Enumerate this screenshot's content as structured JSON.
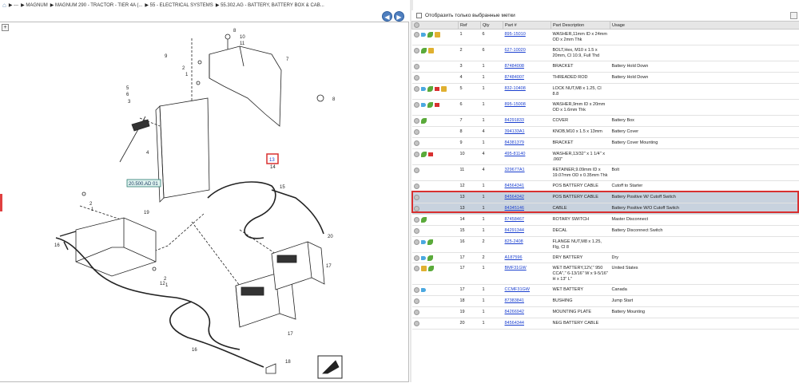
{
  "breadcrumb": [
    "---",
    "MAGNUM",
    "MAGNUM 290 - TRACTOR - TIER 4A (...",
    "55 - ELECTRICAL SYSTEMS",
    "55.302.AG - BATTERY, BATTERY BOX & CAB..."
  ],
  "filter_label": "Отобразить только выбранные метки",
  "columns": [
    "Ref",
    "Qty",
    "Part #",
    "Part Description",
    "Usage"
  ],
  "rows": [
    {
      "icons": [
        "arr",
        "leaf",
        "book"
      ],
      "ref": "1",
      "qty": "6",
      "part": "895-15010",
      "desc": "WASHER,11mm ID x 24mm OD x 2mm Thk",
      "usage": ""
    },
    {
      "icons": [
        "leaf",
        "book"
      ],
      "ref": "2",
      "qty": "6",
      "part": "627-10020",
      "desc": "BOLT,Hex, M10 x 1.5 x 20mm, Cl 10.9, Full Thd",
      "usage": ""
    },
    {
      "icons": [],
      "ref": "3",
      "qty": "1",
      "part": "87484008",
      "desc": "BRACKET",
      "usage": "Battery Hold Down"
    },
    {
      "icons": [],
      "ref": "4",
      "qty": "1",
      "part": "87484007",
      "desc": "THREADED ROD",
      "usage": "Battery Hold Down"
    },
    {
      "icons": [
        "arr",
        "leaf",
        "flag",
        "book"
      ],
      "ref": "5",
      "qty": "1",
      "part": "832-10408",
      "desc": "LOCK NUT,M8 x 1.25, Cl 8.8",
      "usage": ""
    },
    {
      "icons": [
        "arr",
        "leaf",
        "flag"
      ],
      "ref": "6",
      "qty": "1",
      "part": "895-15008",
      "desc": "WASHER,9mm ID x 20mm OD x 1.6mm Thk",
      "usage": ""
    },
    {
      "icons": [
        "leaf"
      ],
      "ref": "7",
      "qty": "1",
      "part": "84291833",
      "desc": "COVER",
      "usage": "Battery Box"
    },
    {
      "icons": [],
      "ref": "8",
      "qty": "4",
      "part": "394133A1",
      "desc": "KNOB,M10 x 1.5 x 13mm",
      "usage": "Battery Cover"
    },
    {
      "icons": [],
      "ref": "9",
      "qty": "1",
      "part": "84381379",
      "desc": "BRACKET",
      "usage": "Battery Cover Mounting"
    },
    {
      "icons": [
        "leaf",
        "flag"
      ],
      "ref": "10",
      "qty": "4",
      "part": "495-81140",
      "desc": "WASHER,13/32\" x 1 1/4\" x .060\"",
      "usage": ""
    },
    {
      "icons": [],
      "ref": "11",
      "qty": "4",
      "part": "329677A1",
      "desc": "RETAINER,9.09mm ID x 19.07mm OD x 0.35mm Thk",
      "usage": "Bolt"
    },
    {
      "icons": [],
      "ref": "12",
      "qty": "1",
      "part": "84564341",
      "desc": "POS BATTERY CABLE",
      "usage": "Cutoff to Starter"
    },
    {
      "icons": [],
      "ref": "13",
      "qty": "1",
      "part": "84564342",
      "desc": "POS BATTERY CABLE",
      "usage": "Battery Positive W/ Cutoff Switch",
      "sel": true
    },
    {
      "icons": [],
      "ref": "13",
      "qty": "1",
      "part": "84345146",
      "desc": "CABLE",
      "usage": "Battery Positive W/O Cutoff Switch",
      "sel": true
    },
    {
      "icons": [
        "leaf"
      ],
      "ref": "14",
      "qty": "1",
      "part": "87458467",
      "desc": "ROTARY SWITCH",
      "usage": "Master Disconnect"
    },
    {
      "icons": [],
      "ref": "15",
      "qty": "1",
      "part": "84291344",
      "desc": "DECAL",
      "usage": "Battery Disconnect Switch"
    },
    {
      "icons": [
        "arr",
        "leaf"
      ],
      "ref": "16",
      "qty": "2",
      "part": "825-2408",
      "desc": "FLANGE NUT,M8 x 1.25, Flg, Cl 8",
      "usage": ""
    },
    {
      "icons": [
        "arr",
        "leaf"
      ],
      "ref": "17",
      "qty": "2",
      "part": "A187596",
      "desc": "DRY BATTERY",
      "usage": "Dry"
    },
    {
      "icons": [
        "book",
        "leaf"
      ],
      "ref": "17",
      "qty": "1",
      "part": "BMF31GW",
      "desc": "WET BATTERY,12V,\" 950 CCA\",\" 6-13/16\" W x 9-5/16\" H x 13\" L\"",
      "usage": "United States"
    },
    {
      "icons": [
        "arr"
      ],
      "ref": "17",
      "qty": "1",
      "part": "CCMF31GW",
      "desc": "WET BATTERY",
      "usage": "Canada"
    },
    {
      "icons": [],
      "ref": "18",
      "qty": "1",
      "part": "87383841",
      "desc": "BUSHING",
      "usage": "Jump Start"
    },
    {
      "icons": [],
      "ref": "19",
      "qty": "1",
      "part": "84266942",
      "desc": "MOUNTING PLATE",
      "usage": "Battery Mounting"
    },
    {
      "icons": [],
      "ref": "20",
      "qty": "1",
      "part": "84564344",
      "desc": "NEG BATTERY CABLE",
      "usage": ""
    }
  ],
  "diagram": {
    "tag_label": "20.500.AD 01",
    "highlight_ref": "13",
    "callouts": [
      "8",
      "10",
      "11",
      "7",
      "9",
      "2",
      "1",
      "5",
      "6",
      "3",
      "8",
      "4",
      "13",
      "14",
      "15",
      "2",
      "1",
      "19",
      "16",
      "20",
      "17",
      "2",
      "1",
      "12",
      "17",
      "16",
      "18"
    ]
  }
}
